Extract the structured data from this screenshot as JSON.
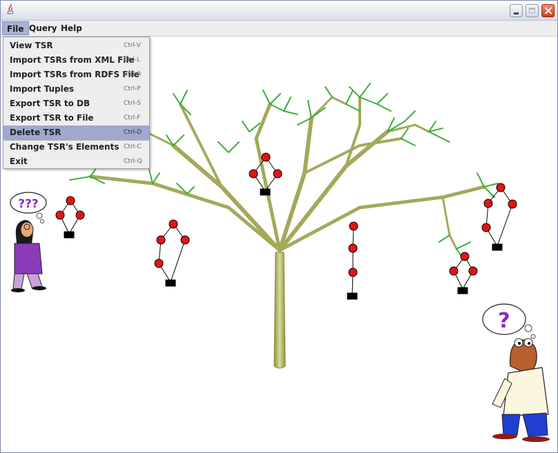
{
  "menubar": {
    "items": [
      {
        "label": "File"
      },
      {
        "label": "Query"
      },
      {
        "label": "Help"
      }
    ]
  },
  "file_menu": {
    "items": [
      {
        "label": "View TSR",
        "shortcut": "Ctrl-V"
      },
      {
        "label": "Import TSRs from XML File",
        "shortcut": "Ctrl-L"
      },
      {
        "label": "Import TSRs from RDFS File",
        "shortcut": "Ctrl-R"
      },
      {
        "label": "Import Tuples",
        "shortcut": "Ctrl-P"
      },
      {
        "label": "Export TSR to DB",
        "shortcut": "Ctrl-S"
      },
      {
        "label": "Export TSR to File",
        "shortcut": "Ctrl-F"
      },
      {
        "label": "Delete TSR",
        "shortcut": "Ctrl-D"
      },
      {
        "label": "Change TSR's Elements",
        "shortcut": "Ctrl-C"
      },
      {
        "label": "Exit",
        "shortcut": "Ctrl-Q"
      }
    ],
    "selected_label": "Delete TSR"
  },
  "canvas": {
    "left_character_thought": "???",
    "right_character_thought": "?"
  },
  "colors": {
    "menu_highlight": "#a0a8d0",
    "tree_trunk": "#b8bc6a",
    "leaf_green": "#3cae3a",
    "node_red": "#e31414",
    "node_black": "#000000"
  }
}
